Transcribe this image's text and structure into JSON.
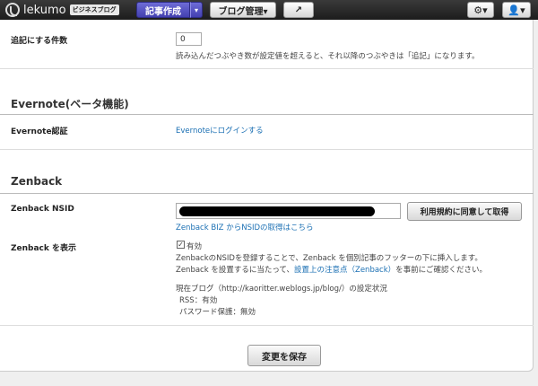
{
  "header": {
    "logo_text": "lekumo",
    "logo_badge": "ビジネスブログ",
    "write_label": "記事作成",
    "write_caret": "▾",
    "blog_manage_label": "ブログ管理▾",
    "external_icon": "↗",
    "gear_label": "⚙▾",
    "user_label": "👤▾"
  },
  "tweets": {
    "label": "追記にする件数",
    "value": "0",
    "desc": "読み込んだつぶやき数が設定値を超えると、それ以降のつぶやきは「追記」になります。"
  },
  "evernote": {
    "title": "Evernote(ベータ機能)",
    "auth_label": "Evernote認証",
    "login_link": "Evernoteにログインする"
  },
  "zenback": {
    "title": "Zenback",
    "nsid_label": "Zenback NSID",
    "agree_button": "利用規約に同意して取得",
    "nsid_link": "Zenback BIZ からNSIDの取得はこちら",
    "show_label": "Zenback を表示",
    "checkbox_mark": "✓",
    "checkbox_label": "有効",
    "desc1": "ZenbackのNSIDを登録することで、Zenback を個別記事のフッターの下に挿入します。",
    "desc2_pre": "Zenback を設置するに当たって、",
    "desc2_link": "設置上の注意点（Zenback）",
    "desc2_post": "を事前にご確認ください。",
    "status_title": "現在ブログ（http://kaoritter.weblogs.jp/blog/）の設定状況",
    "rss_status": "RSS：有効",
    "password_status": "パスワード保護：無効"
  },
  "footer": {
    "save_button": "変更を保存"
  }
}
